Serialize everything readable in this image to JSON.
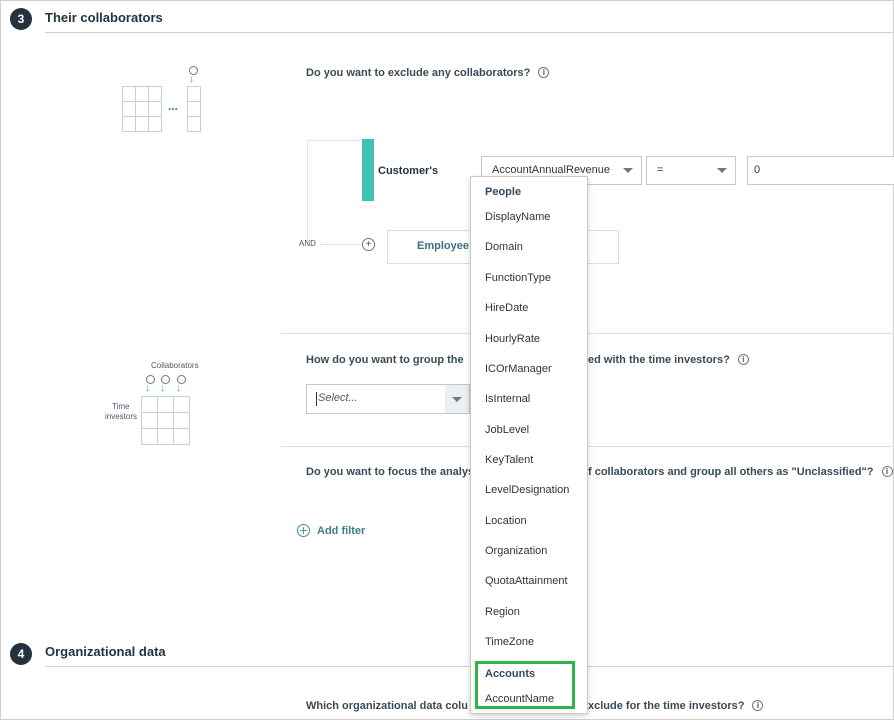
{
  "section3": {
    "number": "3",
    "title": "Their collaborators"
  },
  "section4": {
    "number": "4",
    "title": "Organizational data"
  },
  "questions": {
    "exclude": "Do you want to exclude any collaborators?",
    "group_left": "How do you want to group the",
    "group_right": "ed with the time investors?",
    "focus_left": "Do you want to focus the analys",
    "focus_right": "f collaborators and group all others as \"Unclassified\"?",
    "org_left": "Which organizational data colu",
    "org_right": "xclude for the time investors?"
  },
  "filter": {
    "connector": "AND",
    "entity_label": "Customer's",
    "attribute_value": "AccountAnnualRevenue",
    "operator_value": "=",
    "value_input": "0",
    "employee_button_partial": "Employee"
  },
  "group_select": {
    "placeholder": "Select..."
  },
  "add_filter": {
    "label": "Add filter"
  },
  "illustration": {
    "collaborators_label": "Collaborators",
    "time_investors_line1": "Time",
    "time_investors_line2": "investors",
    "ellipsis": "..."
  },
  "dropdown": {
    "groups": [
      {
        "header": "People",
        "items": [
          "DisplayName",
          "Domain",
          "FunctionType",
          "HireDate",
          "HourlyRate",
          "ICOrManager",
          "IsInternal",
          "JobLevel",
          "KeyTalent",
          "LevelDesignation",
          "Location",
          "Organization",
          "QuotaAttainment",
          "Region",
          "TimeZone"
        ]
      },
      {
        "header": "Accounts",
        "items": [
          "AccountName"
        ]
      }
    ]
  },
  "colors": {
    "step_badge": "#24323f",
    "teal_accent": "#3cc3b0",
    "highlight_box": "#2fb44a",
    "arrow_blue": "#2f9bd6"
  }
}
